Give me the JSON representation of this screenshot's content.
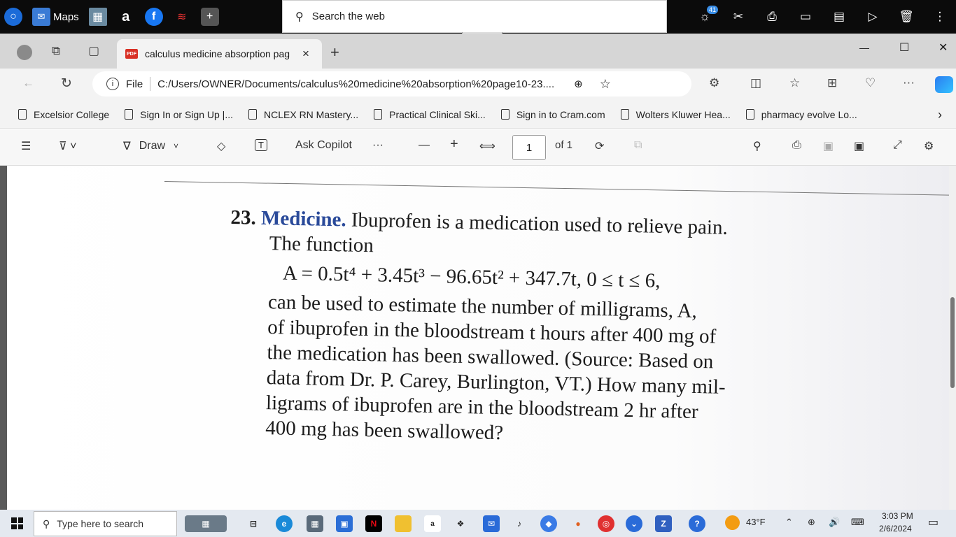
{
  "topbar": {
    "maps_label": "Maps",
    "search_placeholder": "Search the web",
    "notification_count": "41"
  },
  "tab": {
    "title": "calculus medicine absorption pag",
    "close": "×",
    "new_tab": "+",
    "pdf_badge": "PDF"
  },
  "window": {
    "minimize": "—",
    "maximize": "☐",
    "close": "✕"
  },
  "address": {
    "file_label": "File",
    "url": "C:/Users/OWNER/Documents/calculus%20medicine%20absorption%20page10-23...."
  },
  "favorites": [
    "Excelsior College",
    "Sign In or Sign Up |...",
    "NCLEX RN Mastery...",
    "Practical Clinical Ski...",
    "Sign in to Cram.com",
    "Wolters Kluwer Hea...",
    "pharmacy evolve Lo..."
  ],
  "pdf_toolbar": {
    "draw_label": "Draw",
    "ask_copilot": "Ask Copilot",
    "more": "···",
    "zoom_out": "—",
    "zoom_in": "+",
    "page_number": "1",
    "page_total": "of 1"
  },
  "problem": {
    "number": "23.",
    "title": "Medicine.",
    "line1": "Ibuprofen is a medication used to relieve pain.",
    "line2": "The function",
    "equation": "A = 0.5t⁴ + 3.45t³ − 96.65t² + 347.7t, 0 ≤ t ≤ 6,",
    "line3": "can be used to estimate the number of milligrams, A,",
    "line4": "of ibuprofen in the bloodstream t hours after 400 mg of",
    "line5": "the medication has been swallowed. (Source: Based on",
    "line6": "data from Dr. P. Carey, Burlington, VT.) How many mil-",
    "line7": "ligrams of ibuprofen are in the bloodstream 2 hr after",
    "line8": "400 mg has been swallowed?"
  },
  "taskbar": {
    "search_placeholder": "Type here to search",
    "temperature": "43°F",
    "time": "3:03 PM",
    "date": "2/6/2024"
  }
}
